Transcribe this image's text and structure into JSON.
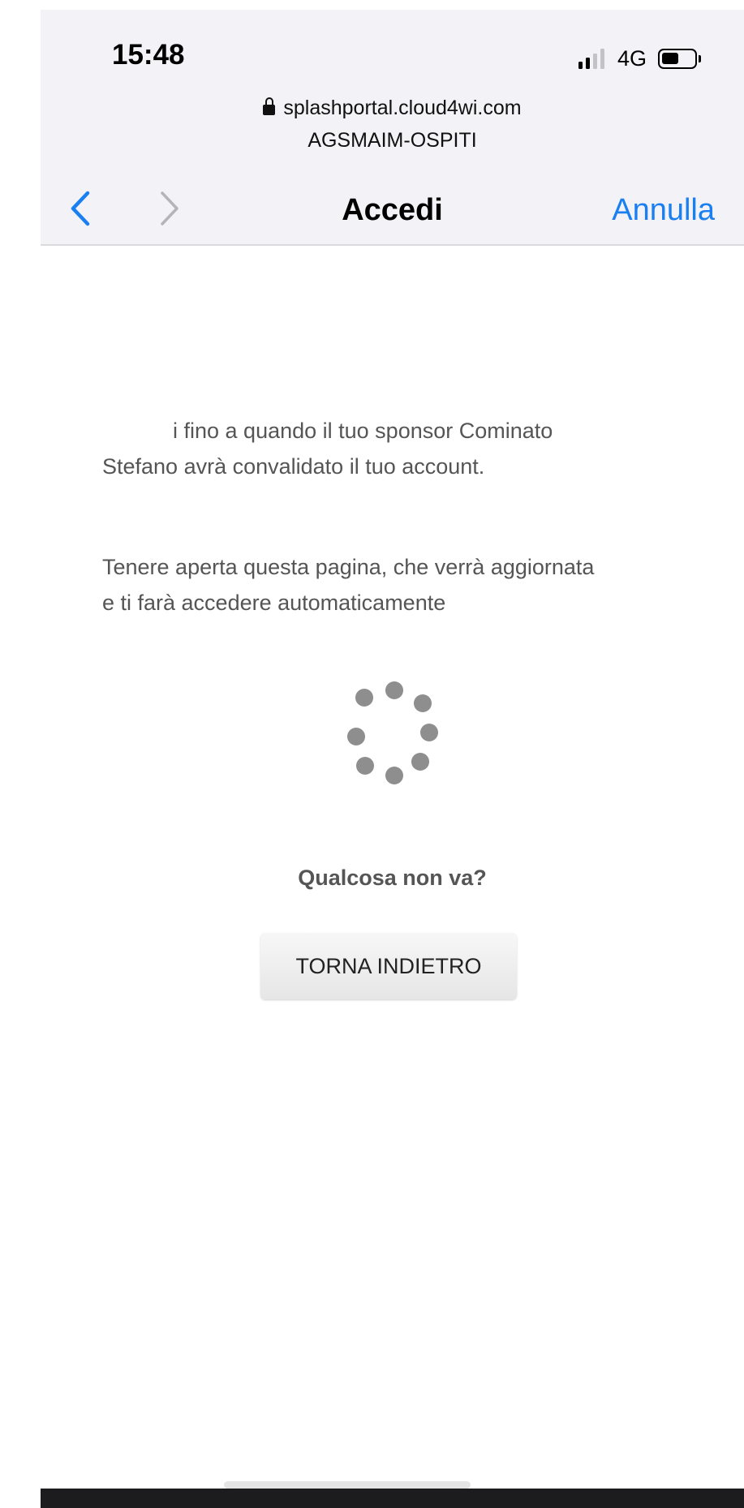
{
  "status_bar": {
    "time": "15:48",
    "network": "4G",
    "signal_bars_active": 2,
    "signal_bars_total": 4,
    "battery_level": 0.45
  },
  "address": {
    "url": "splashportal.cloud4wi.com",
    "network_name": "AGSMAIM-OSPITI"
  },
  "nav": {
    "title": "Accedi",
    "cancel_label": "Annulla",
    "back_icon": "chevron-left-icon",
    "forward_icon": "chevron-right-icon"
  },
  "page": {
    "message_line1": "i fino a quando il tuo sponsor Cominato",
    "message_line2": "Stefano avrà convalidato il tuo account.",
    "info_line1": "Tenere aperta questa pagina, che verrà aggiornata",
    "info_line2": "e ti farà accedere automaticamente",
    "question": "Qualcosa non va?",
    "back_button_label": "TORNA INDIETRO"
  },
  "colors": {
    "accent": "#1a7ff0",
    "header_bg": "#f2f2f7",
    "text_gray": "#555555",
    "spinner": "#8e8e8e"
  }
}
